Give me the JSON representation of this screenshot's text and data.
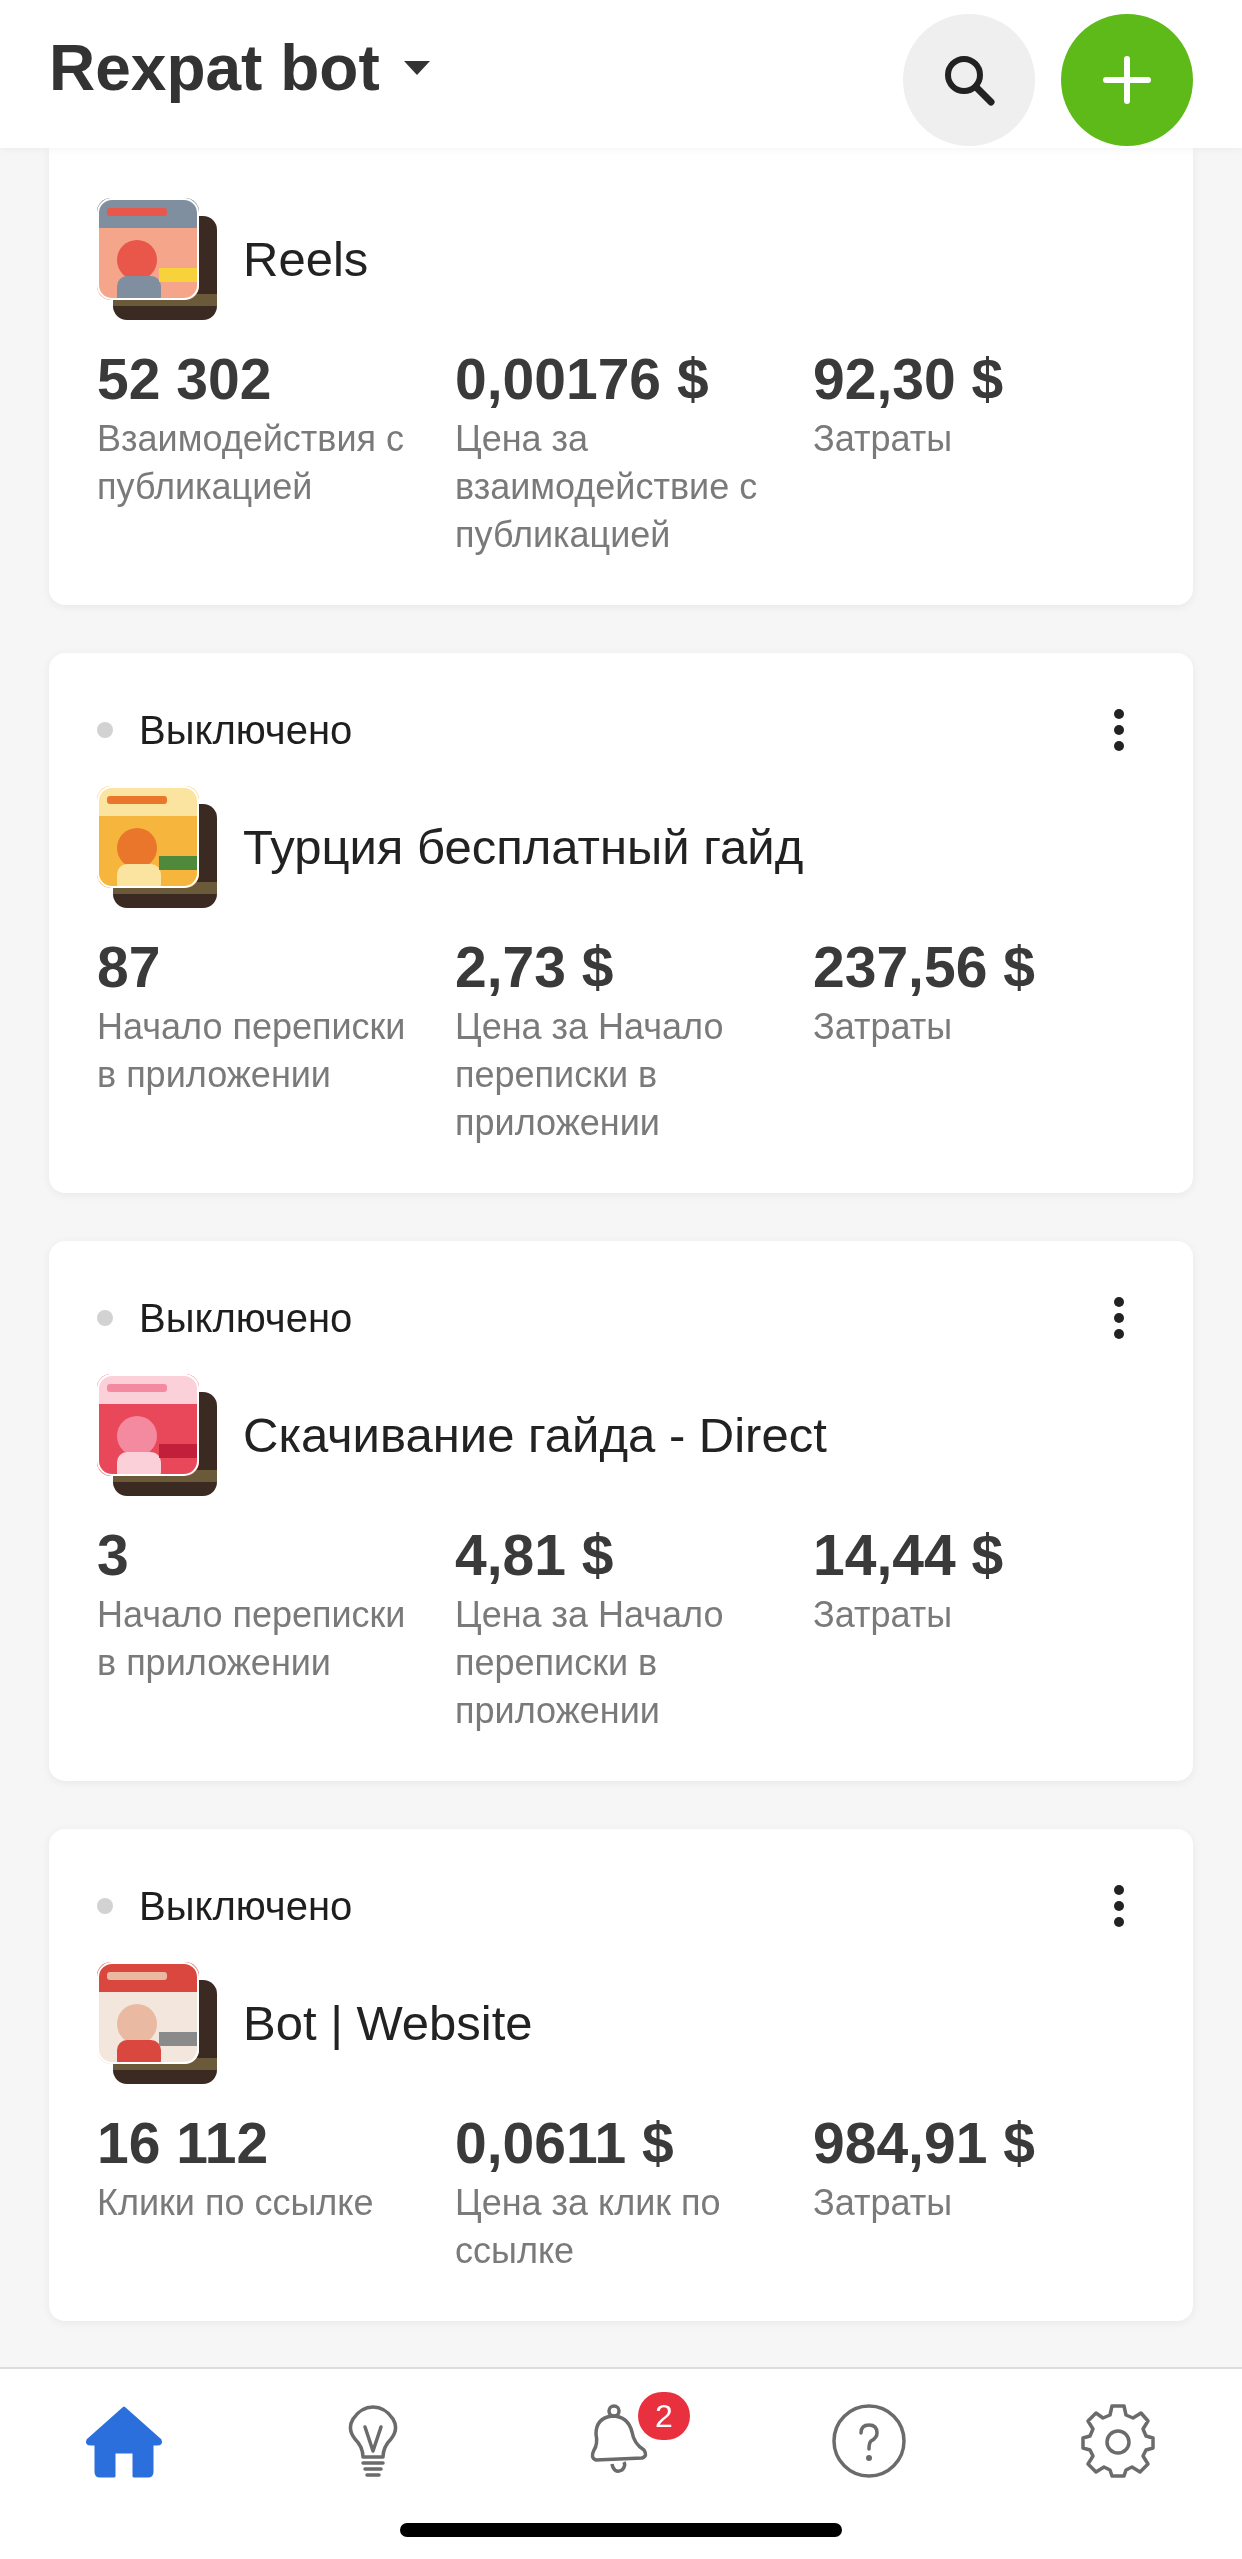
{
  "header": {
    "title": "Rexpat bot"
  },
  "campaigns": [
    {
      "name": "Reels",
      "thumbnail": {
        "kind": "picture"
      },
      "stats": [
        {
          "value": "52 302",
          "label": "Взаимодействия с публикацией"
        },
        {
          "value": "0,00176 $",
          "label": "Цена за взаимодействие с публикацией"
        },
        {
          "value": "92,30 $",
          "label": "Затраты"
        }
      ]
    },
    {
      "status": "Выключено",
      "active": false,
      "name": "Турция бесплатный гайд",
      "thumbnail": {
        "kind": "picture"
      },
      "stats": [
        {
          "value": "87",
          "label": "Начало переписки в приложении"
        },
        {
          "value": "2,73 $",
          "label": "Цена за Начало переписки в приложении"
        },
        {
          "value": "237,56 $",
          "label": "Затраты"
        }
      ]
    },
    {
      "status": "Выключено",
      "active": false,
      "name": "Скачивание гайда - Direct",
      "thumbnail": {
        "kind": "picture"
      },
      "stats": [
        {
          "value": "3",
          "label": "Начало переписки в приложении"
        },
        {
          "value": "4,81 $",
          "label": "Цена за Начало переписки в приложении"
        },
        {
          "value": "14,44 $",
          "label": "Затраты"
        }
      ]
    },
    {
      "status": "Выключено",
      "active": false,
      "name": "Bot | Website",
      "thumbnail": {
        "kind": "picture"
      },
      "stats": [
        {
          "value": "16 112",
          "label": "Клики по ссылке"
        },
        {
          "value": "0,0611 $",
          "label": "Цена за клик по ссылке"
        },
        {
          "value": "984,91 $",
          "label": "Затраты"
        }
      ]
    }
  ],
  "nav": [
    {
      "kind": "home",
      "selected": true
    },
    {
      "kind": "ideas",
      "selected": false
    },
    {
      "kind": "notifications",
      "selected": false,
      "badge": "2"
    },
    {
      "kind": "help",
      "selected": false
    },
    {
      "kind": "settings",
      "selected": false
    }
  ]
}
